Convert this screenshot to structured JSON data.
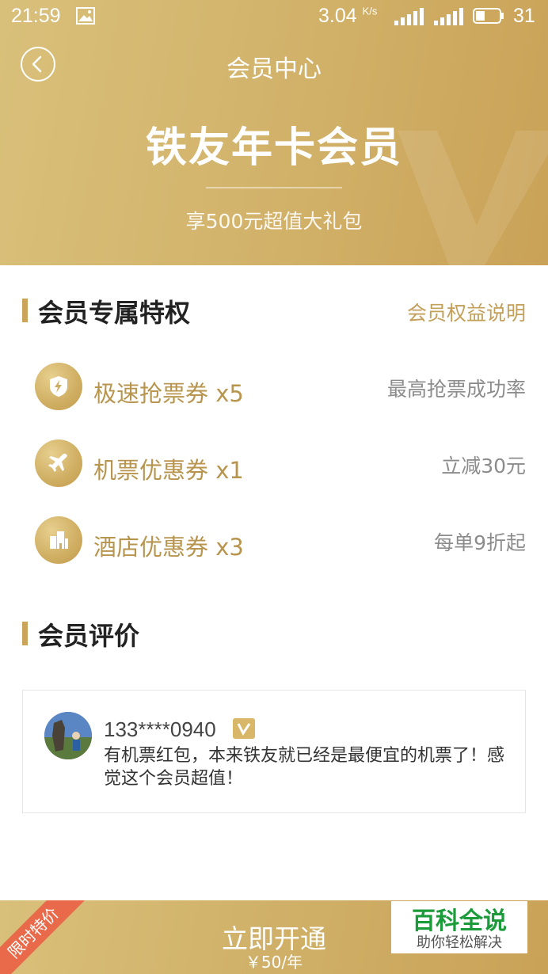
{
  "status_bar": {
    "time": "21:59",
    "speed": "3.04",
    "speed_unit": "K/s",
    "battery": "31",
    "icons": [
      "image-icon",
      "signal-icon",
      "4g-signal-icon",
      "battery-icon"
    ]
  },
  "header": {
    "back_icon": "chevron-left-icon",
    "title": "会员中心"
  },
  "hero": {
    "title": "铁友年卡会员",
    "subtitle": "享500元超值大礼包"
  },
  "privileges": {
    "title": "会员专属特权",
    "link": "会员权益说明",
    "items": [
      {
        "icon": "lightning-shield-icon",
        "label": "极速抢票券 x5",
        "desc": "最高抢票成功率"
      },
      {
        "icon": "airplane-icon",
        "label": "机票优惠券 x1",
        "desc": "立减30元"
      },
      {
        "icon": "hotel-building-icon",
        "label": "酒店优惠券 x3",
        "desc": "每单9折起"
      }
    ]
  },
  "reviews": {
    "title": "会员评价",
    "items": [
      {
        "user": "133****0940",
        "badge_icon": "v-member-badge-icon",
        "text": "有机票红包，本来铁友就已经是最便宜的机票了！感觉这个会员超值！"
      }
    ]
  },
  "footer": {
    "ribbon": "限时特价",
    "button_label": "立即开通",
    "price": "￥50/年"
  },
  "watermark": {
    "title": "百科全说",
    "subtitle": "助你轻松解决"
  },
  "colors": {
    "gold": "#d3b46c",
    "gold_text": "#b8954e",
    "ribbon": "#e86a4a",
    "watermark_green": "#1c9b3a"
  }
}
